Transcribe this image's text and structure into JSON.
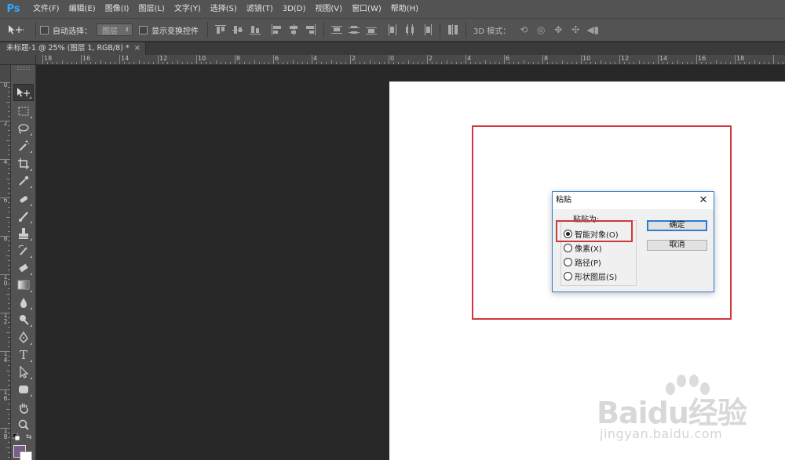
{
  "app": {
    "logo": "Ps"
  },
  "menu": {
    "items": [
      "文件(F)",
      "编辑(E)",
      "图像(I)",
      "图层(L)",
      "文字(Y)",
      "选择(S)",
      "滤镜(T)",
      "3D(D)",
      "视图(V)",
      "窗口(W)",
      "帮助(H)"
    ]
  },
  "options": {
    "auto_select_label": "自动选择：",
    "auto_select_value": "图层",
    "show_transform_label": "显示变换控件",
    "mode3d_label": "3D 模式："
  },
  "document": {
    "tab_title": "未标题-1 @ 25% (图层 1, RGB/8) *",
    "tab_close": "×"
  },
  "ruler": {
    "top_labels": [
      "18",
      "16",
      "14",
      "12",
      "10",
      "8",
      "6",
      "4",
      "2",
      "0",
      "2",
      "4",
      "6",
      "8",
      "10",
      "12",
      "14",
      "16",
      "18"
    ],
    "left_labels": [
      "0",
      "2",
      "4",
      "6",
      "8",
      "1 0",
      "1 2",
      "1 4",
      "1 6",
      "1 8"
    ]
  },
  "dialog": {
    "title": "粘贴",
    "close": "✕",
    "group_label": "粘贴为:",
    "options": [
      {
        "label": "智能对象(O)",
        "checked": true
      },
      {
        "label": "像素(X)",
        "checked": false
      },
      {
        "label": "路径(P)",
        "checked": false
      },
      {
        "label": "形状图层(S)",
        "checked": false
      }
    ],
    "ok_label": "确定",
    "cancel_label": "取消"
  },
  "colors": {
    "foreground": "#7a5e89",
    "background": "#ffffff",
    "highlight": "#d0363e",
    "accent": "#31a8ff"
  },
  "watermark": {
    "logo_text": "Baidu经验",
    "url": "jingyan.baidu.com"
  }
}
